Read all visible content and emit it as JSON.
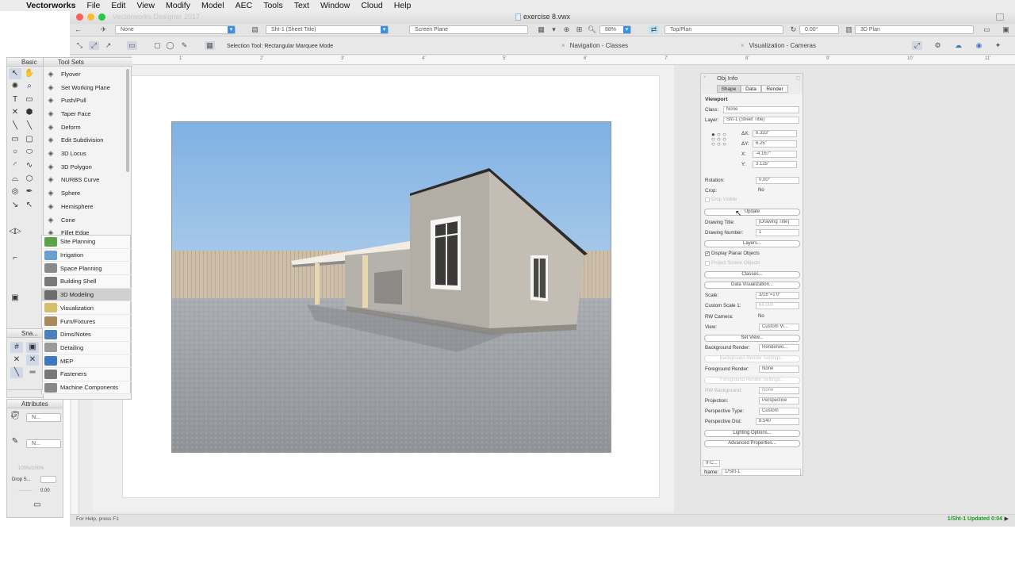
{
  "menubar": {
    "app": "Vectorworks",
    "items": [
      "File",
      "Edit",
      "View",
      "Modify",
      "Model",
      "AEC",
      "Tools",
      "Text",
      "Window",
      "Cloud",
      "Help"
    ]
  },
  "window": {
    "app_title": "Vectorworks Designer 2017",
    "doc_title": "exercise 8.vwx"
  },
  "viewbar": {
    "class": "None",
    "layer": "Sht-1 (Sheet Title)",
    "plane": "Screen Plane",
    "zoom": "88%",
    "view": "Top/Plan",
    "angle": "0.00°",
    "render": "3D Plan"
  },
  "modebar": {
    "hint": "Selection Tool: Rectangular Marquee Mode",
    "tab1": "Navigation - Classes",
    "tab2": "Visualization - Cameras"
  },
  "ruler": {
    "labels": [
      "1'",
      "2'",
      "3'",
      "4'",
      "5'",
      "6'",
      "7'",
      "8'",
      "9'",
      "10'",
      "11'"
    ]
  },
  "palettes": {
    "basic": "Basic",
    "tool_sets": "Tool Sets",
    "snap": "Sna...",
    "attributes": "Attributes",
    "attr_fill": "N...",
    "attr_pen": "N...",
    "opacity": "100%/100%",
    "drop_shadow": "Drop S...",
    "line_weight": "0.00"
  },
  "tools": [
    {
      "label": "Flyover",
      "icon": "flyover-icon"
    },
    {
      "label": "Set Working Plane",
      "icon": "working-plane-icon"
    },
    {
      "label": "Push/Pull",
      "icon": "push-pull-icon"
    },
    {
      "label": "Taper Face",
      "icon": "taper-face-icon"
    },
    {
      "label": "Deform",
      "icon": "deform-icon"
    },
    {
      "label": "Edit Subdivision",
      "icon": "subdivision-icon"
    },
    {
      "label": "3D Locus",
      "icon": "locus-icon"
    },
    {
      "label": "3D Polygon",
      "icon": "polygon-icon"
    },
    {
      "label": "NURBS Curve",
      "icon": "nurbs-icon"
    },
    {
      "label": "Sphere",
      "icon": "sphere-icon"
    },
    {
      "label": "Hemisphere",
      "icon": "hemisphere-icon"
    },
    {
      "label": "Cone",
      "icon": "cone-icon"
    },
    {
      "label": "Fillet Edge",
      "icon": "fillet-icon"
    }
  ],
  "toolsets": [
    {
      "label": "Site Planning",
      "color": "#5aa34a"
    },
    {
      "label": "Irrigation",
      "color": "#6b9fd1"
    },
    {
      "label": "Space Planning",
      "color": "#8a8a8a"
    },
    {
      "label": "Building Shell",
      "color": "#7a7a7a"
    },
    {
      "label": "3D Modeling",
      "color": "#6d6d6d"
    },
    {
      "label": "Visualization",
      "color": "#d4c06a"
    },
    {
      "label": "Furn/Fixtures",
      "color": "#a88a5c"
    },
    {
      "label": "Dims/Notes",
      "color": "#4d7fb8"
    },
    {
      "label": "Detailing",
      "color": "#9a9a9a"
    },
    {
      "label": "MEP",
      "color": "#3e78c4"
    },
    {
      "label": "Fasteners",
      "color": "#777777"
    },
    {
      "label": "Machine Components",
      "color": "#888888"
    }
  ],
  "toolsets_highlight": 4,
  "objinfo": {
    "title": "Obj Info",
    "tabs": [
      "Shape",
      "Data",
      "Render"
    ],
    "section": "Viewport",
    "class_label": "Class:",
    "class_value": "None",
    "layer_label": "Layer:",
    "layer_value": "Sht-1 (Sheet Title)",
    "dx_label": "ΔX:",
    "dx": "6.333\"",
    "dy_label": "ΔY:",
    "dy": "6.25\"",
    "x_label": "X:",
    "x": "-4.167\"",
    "y_label": "Y:",
    "y": "3.125\"",
    "rotation_label": "Rotation:",
    "rotation": "0.00°",
    "crop_label": "Crop:",
    "crop": "No",
    "crop_visible": "Crop Visible",
    "update": "Update",
    "drawing_title_label": "Drawing Title:",
    "drawing_title": "[Drawing Title]",
    "drawing_number_label": "Drawing Number:",
    "drawing_number": "1",
    "layers_btn": "Layers...",
    "display_planar": "Display Planar Objects",
    "project_screen": "Project Screen Objects",
    "classes_btn": "Classes...",
    "data_vis_btn": "Data Visualization...",
    "scale_label": "Scale:",
    "scale": "3/16\"=1'0\"",
    "custom_scale_label": "Custom Scale 1:",
    "custom_scale": "64.000",
    "rw_camera_label": "RW Camera:",
    "rw_camera": "No",
    "view_label": "View:",
    "view": "Custom Vi...",
    "set_view": "Set View...",
    "bg_render_label": "Background Render:",
    "bg_render": "Renderwo...",
    "bg_settings": "Background Render Settings...",
    "fg_render_label": "Foreground Render:",
    "fg_render": "None",
    "fg_settings": "Foreground Render Settings...",
    "rw_bg_label": "RW Background:",
    "rw_bg": "None",
    "projection_label": "Projection:",
    "projection": "Perspective",
    "persp_type_label": "Perspective Type:",
    "persp_type": "Custom",
    "persp_dist_label": "Perspective Dist:",
    "persp_dist": "8.540",
    "lighting_btn": "Lighting Options...",
    "advanced_btn": "Advanced Properties...",
    "ifc_btn": "IFC...",
    "name_label": "Name:",
    "name": "1/Sht-1"
  },
  "status": {
    "help": "For Help, press F1",
    "right": "1/Sht-1 Updated 0:04"
  }
}
